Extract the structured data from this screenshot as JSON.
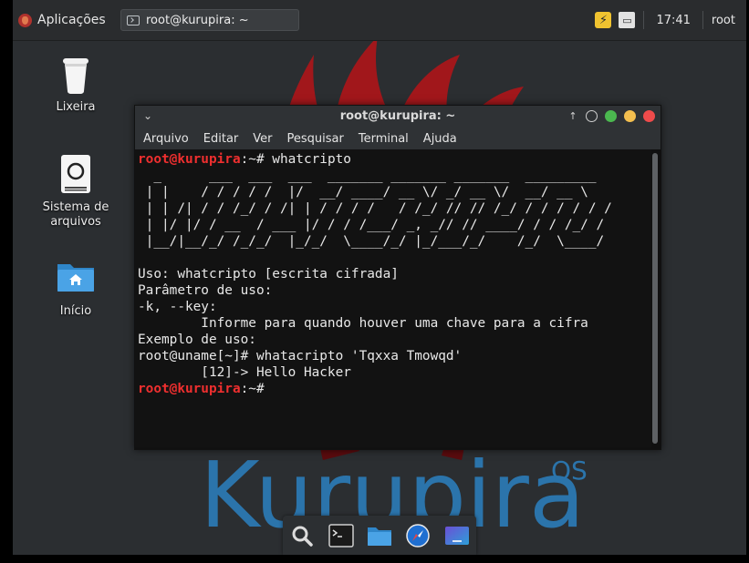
{
  "panel": {
    "apps_label": "Aplicações",
    "task_title": "root@kurupira: ~",
    "clock": "17:41",
    "user": "root"
  },
  "desktop": {
    "icons": [
      {
        "label": "Lixeira",
        "icon": "trash-icon"
      },
      {
        "label": "Sistema de\narquivos",
        "icon": "drive-icon"
      },
      {
        "label": "Início",
        "icon": "home-folder-icon"
      }
    ]
  },
  "wallpaper": {
    "brand": "Kurupira",
    "brand_suffix": "OS",
    "brand_color": "#2b74ab",
    "flame_color": "#b3171b"
  },
  "terminal": {
    "title": "root@kurupira: ~",
    "menu": [
      "Arquivo",
      "Editar",
      "Ver",
      "Pesquisar",
      "Terminal",
      "Ajuda"
    ],
    "prompt_user": "root@kurupira",
    "prompt_path": ":~#",
    "command": " whatcripto",
    "ascii_art": "  _      ___  ___  ___  _______ _______ _______  _________\n | |    / / / / /  |/  __/ ____/ __ \\/ _/ __ \\/  __/ __ \\\n | | /| / / /_/ / /| | / / / /   / /_/ // // /_/ / / / / / /\n | |/ |/ / __  / ___ |/ / / /___/ _, _// // ____/ / / /_/ /\n |__/|__/_/ /_/_/  |_/_/  \\____/_/ |_/___/_/    /_/  \\____/",
    "output": "Uso: whatcripto [escrita cifrada]\nParâmetro de uso:\n-k, --key:\n        Informe para quando houver uma chave para a cifra\nExemplo de uso:\nroot@uname[~]# whatacripto 'Tqxxa Tmowqd'\n        [12]-> Hello Hacker"
  },
  "dock": {
    "items": [
      "search-icon",
      "terminal-icon",
      "folder-icon",
      "browser-icon",
      "desktop-icon"
    ]
  }
}
